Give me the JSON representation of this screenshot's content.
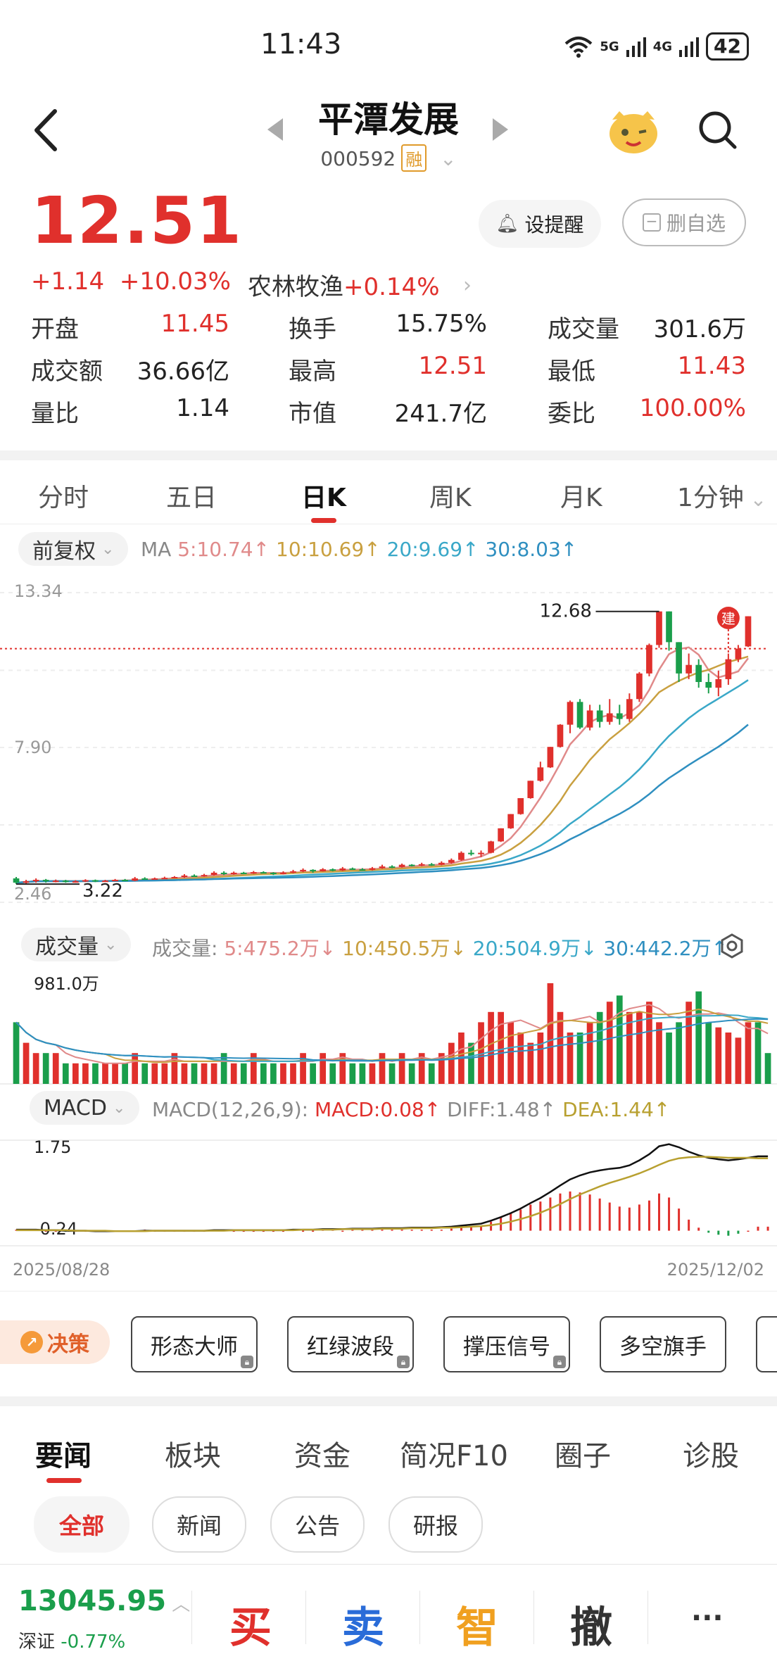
{
  "status_bar": {
    "time": "11:43",
    "network_1": "5G",
    "network_2": "4G",
    "battery": "42"
  },
  "header": {
    "title": "平潭发展",
    "code": "000592",
    "margin_tag": "融"
  },
  "quote": {
    "price": "12.51",
    "change": "+1.14",
    "change_pct": "+10.03%",
    "sector": "农林牧渔",
    "sector_change": "+0.14%",
    "alert_button": "设提醒",
    "remove_button": "删自选"
  },
  "stats": [
    {
      "label": "开盘",
      "value": "11.45",
      "color": "red"
    },
    {
      "label": "换手",
      "value": "15.75%",
      "color": "black"
    },
    {
      "label": "成交量",
      "value": "301.6万",
      "color": "black"
    },
    {
      "label": "成交额",
      "value": "36.66亿",
      "color": "black"
    },
    {
      "label": "最高",
      "value": "12.51",
      "color": "red"
    },
    {
      "label": "最低",
      "value": "11.43",
      "color": "red"
    },
    {
      "label": "量比",
      "value": "1.14",
      "color": "black"
    },
    {
      "label": "市值",
      "value": "241.7亿",
      "color": "black"
    },
    {
      "label": "委比",
      "value": "100.00%",
      "color": "red"
    }
  ],
  "chart_tabs": [
    "分时",
    "五日",
    "日K",
    "周K",
    "月K",
    "1分钟"
  ],
  "active_chart_tab": "日K",
  "adjust": "前复权",
  "ma": {
    "label": "MA",
    "ma5": "5:10.74",
    "ma10": "10:10.69",
    "ma20": "20:9.69",
    "ma30": "30:8.03"
  },
  "volume_panel": {
    "selector": "成交量",
    "label": "成交量:",
    "v5": "5:475.2万",
    "v10": "10:450.5万",
    "v20": "20:504.9万",
    "v30": "30:442.2万",
    "max_label": "981.0万"
  },
  "macd_panel": {
    "selector": "MACD",
    "params": "MACD(12,26,9):",
    "macd": "MACD:0.08",
    "diff": "DIFF:1.48",
    "dea": "DEA:1.44",
    "top_label": "1.75",
    "bottom_label": "-0.24"
  },
  "dates": {
    "start": "2025/08/28",
    "end": "2025/12/02"
  },
  "colors": {
    "up": "#e0302c",
    "down": "#1a9e4b",
    "ma5": "#e08a8a",
    "ma10": "#c9a040",
    "ma20": "#3aa8c8",
    "ma30": "#2f8fc0",
    "diff": "#111111",
    "dea": "#b8a030"
  },
  "tools": {
    "decision": "决策",
    "items": [
      "形态大师",
      "红绿波段",
      "撑压信号",
      "多空旗手"
    ]
  },
  "news_tabs": [
    "要闻",
    "板块",
    "资金",
    "简况F10",
    "圈子",
    "诊股"
  ],
  "news_filters": [
    "全部",
    "新闻",
    "公告",
    "研报"
  ],
  "bottom": {
    "index_value": "13045.95",
    "index_name": "深证",
    "index_change": "-0.77%",
    "buy": "买",
    "sell": "卖",
    "smart": "智",
    "cancel": "撤",
    "more": "···"
  },
  "chart_data": {
    "type": "candlestick",
    "y_axis_labels": [
      "13.34",
      "7.90",
      "2.46"
    ],
    "ylim": [
      2.46,
      13.34
    ],
    "annotations": {
      "high_label": "12.68",
      "low_label": "3.22",
      "marker": "建"
    },
    "candles": [
      {
        "o": 3.3,
        "c": 3.15,
        "h": 3.35,
        "l": 3.1
      },
      {
        "o": 3.15,
        "c": 3.2,
        "h": 3.25,
        "l": 3.1
      },
      {
        "o": 3.2,
        "c": 3.25,
        "h": 3.3,
        "l": 3.15
      },
      {
        "o": 3.25,
        "c": 3.2,
        "h": 3.28,
        "l": 3.15
      },
      {
        "o": 3.2,
        "c": 3.22,
        "h": 3.26,
        "l": 3.16
      },
      {
        "o": 3.22,
        "c": 3.18,
        "h": 3.25,
        "l": 3.15
      },
      {
        "o": 3.18,
        "c": 3.2,
        "h": 3.24,
        "l": 3.15
      },
      {
        "o": 3.2,
        "c": 3.24,
        "h": 3.27,
        "l": 3.17
      },
      {
        "o": 3.24,
        "c": 3.2,
        "h": 3.26,
        "l": 3.17
      },
      {
        "o": 3.2,
        "c": 3.22,
        "h": 3.25,
        "l": 3.18
      },
      {
        "o": 3.22,
        "c": 3.25,
        "h": 3.28,
        "l": 3.2
      },
      {
        "o": 3.25,
        "c": 3.22,
        "h": 3.28,
        "l": 3.2
      },
      {
        "o": 3.22,
        "c": 3.3,
        "h": 3.35,
        "l": 3.2
      },
      {
        "o": 3.3,
        "c": 3.28,
        "h": 3.34,
        "l": 3.25
      },
      {
        "o": 3.28,
        "c": 3.3,
        "h": 3.33,
        "l": 3.26
      },
      {
        "o": 3.3,
        "c": 3.32,
        "h": 3.36,
        "l": 3.28
      },
      {
        "o": 3.32,
        "c": 3.35,
        "h": 3.38,
        "l": 3.3
      },
      {
        "o": 3.35,
        "c": 3.4,
        "h": 3.45,
        "l": 3.32
      },
      {
        "o": 3.4,
        "c": 3.38,
        "h": 3.44,
        "l": 3.35
      },
      {
        "o": 3.38,
        "c": 3.42,
        "h": 3.46,
        "l": 3.36
      },
      {
        "o": 3.42,
        "c": 3.5,
        "h": 3.55,
        "l": 3.4
      },
      {
        "o": 3.5,
        "c": 3.45,
        "h": 3.55,
        "l": 3.42
      },
      {
        "o": 3.45,
        "c": 3.5,
        "h": 3.54,
        "l": 3.43
      },
      {
        "o": 3.5,
        "c": 3.48,
        "h": 3.53,
        "l": 3.45
      },
      {
        "o": 3.48,
        "c": 3.52,
        "h": 3.56,
        "l": 3.46
      },
      {
        "o": 3.52,
        "c": 3.5,
        "h": 3.55,
        "l": 3.48
      },
      {
        "o": 3.5,
        "c": 3.45,
        "h": 3.52,
        "l": 3.42
      },
      {
        "o": 3.45,
        "c": 3.5,
        "h": 3.55,
        "l": 3.44
      },
      {
        "o": 3.5,
        "c": 3.55,
        "h": 3.6,
        "l": 3.48
      },
      {
        "o": 3.55,
        "c": 3.6,
        "h": 3.65,
        "l": 3.52
      },
      {
        "o": 3.6,
        "c": 3.55,
        "h": 3.62,
        "l": 3.5
      },
      {
        "o": 3.55,
        "c": 3.62,
        "h": 3.66,
        "l": 3.54
      },
      {
        "o": 3.62,
        "c": 3.58,
        "h": 3.65,
        "l": 3.55
      },
      {
        "o": 3.58,
        "c": 3.65,
        "h": 3.7,
        "l": 3.56
      },
      {
        "o": 3.65,
        "c": 3.62,
        "h": 3.68,
        "l": 3.6
      },
      {
        "o": 3.62,
        "c": 3.6,
        "h": 3.66,
        "l": 3.57
      },
      {
        "o": 3.6,
        "c": 3.66,
        "h": 3.7,
        "l": 3.58
      },
      {
        "o": 3.66,
        "c": 3.72,
        "h": 3.78,
        "l": 3.64
      },
      {
        "o": 3.72,
        "c": 3.7,
        "h": 3.76,
        "l": 3.66
      },
      {
        "o": 3.7,
        "c": 3.78,
        "h": 3.82,
        "l": 3.68
      },
      {
        "o": 3.78,
        "c": 3.75,
        "h": 3.8,
        "l": 3.72
      },
      {
        "o": 3.75,
        "c": 3.8,
        "h": 3.85,
        "l": 3.73
      },
      {
        "o": 3.8,
        "c": 3.78,
        "h": 3.84,
        "l": 3.74
      },
      {
        "o": 3.78,
        "c": 3.85,
        "h": 3.9,
        "l": 3.76
      },
      {
        "o": 3.85,
        "c": 3.95,
        "h": 4.0,
        "l": 3.82
      },
      {
        "o": 3.95,
        "c": 4.2,
        "h": 4.25,
        "l": 3.92
      },
      {
        "o": 4.2,
        "c": 4.15,
        "h": 4.3,
        "l": 4.1
      },
      {
        "o": 4.15,
        "c": 4.2,
        "h": 4.28,
        "l": 4.05
      },
      {
        "o": 4.2,
        "c": 4.6,
        "h": 4.62,
        "l": 4.18
      },
      {
        "o": 4.6,
        "c": 5.06,
        "h": 5.06,
        "l": 4.58
      },
      {
        "o": 5.06,
        "c": 5.56,
        "h": 5.56,
        "l": 5.04
      },
      {
        "o": 5.56,
        "c": 6.12,
        "h": 6.12,
        "l": 5.54
      },
      {
        "o": 6.12,
        "c": 6.73,
        "h": 6.73,
        "l": 6.1
      },
      {
        "o": 6.73,
        "c": 7.2,
        "h": 7.4,
        "l": 6.7
      },
      {
        "o": 7.2,
        "c": 7.92,
        "h": 7.92,
        "l": 7.18
      },
      {
        "o": 7.92,
        "c": 8.7,
        "h": 8.72,
        "l": 7.9
      },
      {
        "o": 8.7,
        "c": 9.5,
        "h": 9.55,
        "l": 8.4
      },
      {
        "o": 9.5,
        "c": 8.6,
        "h": 9.6,
        "l": 8.55
      },
      {
        "o": 8.6,
        "c": 9.2,
        "h": 9.4,
        "l": 8.5
      },
      {
        "o": 9.2,
        "c": 8.8,
        "h": 9.4,
        "l": 8.6
      },
      {
        "o": 8.8,
        "c": 9.1,
        "h": 9.6,
        "l": 8.7
      },
      {
        "o": 9.1,
        "c": 8.9,
        "h": 9.4,
        "l": 8.7
      },
      {
        "o": 8.9,
        "c": 9.6,
        "h": 9.8,
        "l": 8.8
      },
      {
        "o": 9.6,
        "c": 10.5,
        "h": 10.55,
        "l": 9.5
      },
      {
        "o": 10.5,
        "c": 11.5,
        "h": 11.55,
        "l": 10.4
      },
      {
        "o": 11.5,
        "c": 12.68,
        "h": 12.68,
        "l": 11.4
      },
      {
        "o": 12.68,
        "c": 11.6,
        "h": 12.68,
        "l": 11.3
      },
      {
        "o": 11.6,
        "c": 10.5,
        "h": 11.6,
        "l": 10.2
      },
      {
        "o": 10.5,
        "c": 10.8,
        "h": 11.2,
        "l": 10.3
      },
      {
        "o": 10.8,
        "c": 10.2,
        "h": 11.0,
        "l": 10.0
      },
      {
        "o": 10.2,
        "c": 10.0,
        "h": 10.5,
        "l": 9.8
      },
      {
        "o": 10.0,
        "c": 10.3,
        "h": 10.6,
        "l": 9.7
      },
      {
        "o": 10.3,
        "c": 11.0,
        "h": 11.2,
        "l": 10.1
      },
      {
        "o": 11.0,
        "c": 11.37,
        "h": 11.5,
        "l": 10.9
      },
      {
        "o": 11.45,
        "c": 12.51,
        "h": 12.51,
        "l": 11.43
      }
    ],
    "volume": [
      6,
      4,
      3,
      3,
      3,
      2,
      2,
      2,
      2,
      2,
      2,
      2,
      3,
      2,
      2,
      2,
      3,
      2,
      2,
      2,
      2,
      3,
      2,
      2,
      3,
      2,
      2,
      2,
      2,
      3,
      2,
      3,
      2,
      3,
      2,
      2,
      2,
      3,
      2,
      3,
      2,
      3,
      2,
      3,
      4,
      5,
      4,
      6,
      7,
      7,
      6,
      5,
      4,
      5,
      9.8,
      7,
      5,
      5,
      6,
      7,
      8,
      8.6,
      7,
      7,
      8,
      6,
      5,
      6,
      8,
      9,
      6,
      5.5,
      5,
      4.5,
      6,
      6,
      3
    ],
    "macd_dif": [
      0.02,
      0.02,
      0.02,
      0.01,
      0.01,
      0.0,
      0.0,
      0.0,
      -0.01,
      -0.01,
      -0.01,
      -0.01,
      -0.01,
      0.0,
      0.0,
      0.0,
      0.0,
      0.0,
      0.0,
      0.0,
      0.01,
      0.01,
      0.01,
      0.01,
      0.01,
      0.01,
      0.01,
      0.01,
      0.02,
      0.02,
      0.02,
      0.03,
      0.03,
      0.03,
      0.04,
      0.04,
      0.04,
      0.05,
      0.05,
      0.05,
      0.06,
      0.06,
      0.06,
      0.07,
      0.08,
      0.1,
      0.12,
      0.14,
      0.2,
      0.27,
      0.35,
      0.44,
      0.55,
      0.65,
      0.77,
      0.9,
      1.02,
      1.1,
      1.16,
      1.2,
      1.23,
      1.25,
      1.3,
      1.4,
      1.52,
      1.68,
      1.72,
      1.66,
      1.57,
      1.5,
      1.45,
      1.42,
      1.4,
      1.42,
      1.45,
      1.48,
      1.48
    ],
    "macd_dea": [
      0.01,
      0.01,
      0.01,
      0.01,
      0.01,
      0.01,
      0.0,
      0.0,
      0.0,
      0.0,
      -0.01,
      -0.01,
      -0.01,
      -0.01,
      0.0,
      0.0,
      0.0,
      0.0,
      0.0,
      0.0,
      0.0,
      0.0,
      0.01,
      0.01,
      0.01,
      0.01,
      0.01,
      0.01,
      0.01,
      0.02,
      0.02,
      0.02,
      0.02,
      0.03,
      0.03,
      0.03,
      0.03,
      0.04,
      0.04,
      0.04,
      0.05,
      0.05,
      0.05,
      0.06,
      0.06,
      0.07,
      0.08,
      0.09,
      0.11,
      0.14,
      0.18,
      0.23,
      0.29,
      0.36,
      0.44,
      0.53,
      0.63,
      0.72,
      0.8,
      0.88,
      0.95,
      1.01,
      1.07,
      1.14,
      1.22,
      1.31,
      1.39,
      1.44,
      1.46,
      1.47,
      1.47,
      1.46,
      1.45,
      1.45,
      1.45,
      1.44,
      1.44
    ]
  }
}
